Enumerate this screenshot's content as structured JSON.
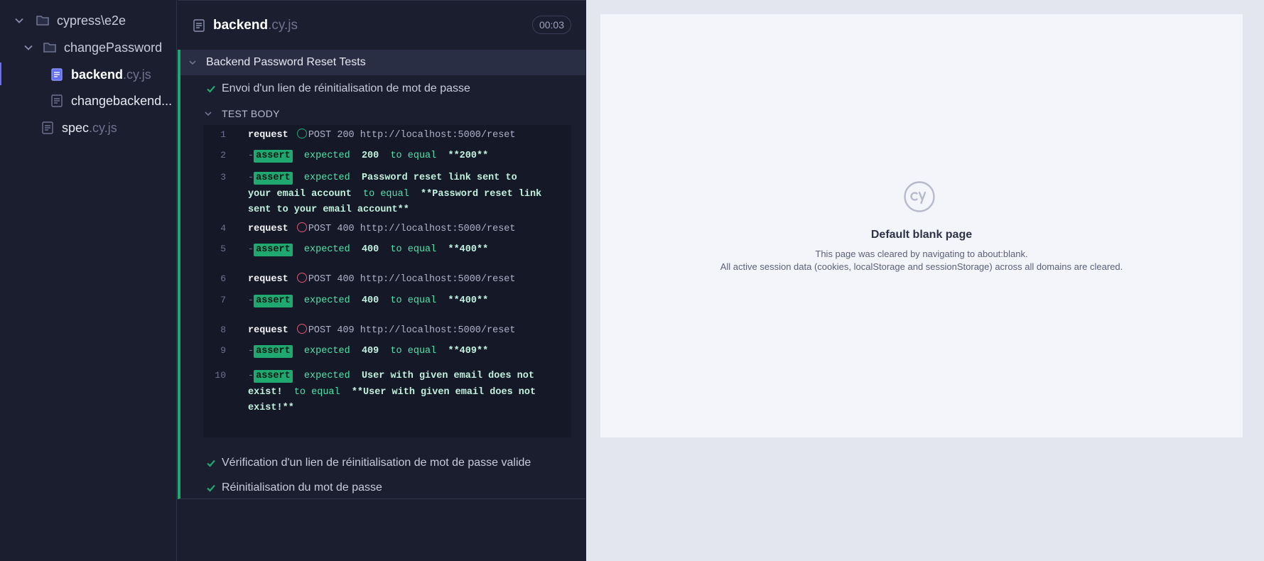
{
  "file_tree": {
    "root_folder": "cypress\\e2e",
    "sub_folder": "changePassword",
    "files": [
      {
        "name": "backend",
        "ext": ".cy.js"
      },
      {
        "name": "changebackend...",
        "ext": ""
      },
      {
        "name": "spec",
        "ext": ".cy.js"
      }
    ]
  },
  "reporter": {
    "spec_file": {
      "name": "backend",
      "ext": ".cy.js"
    },
    "duration": "00:03",
    "suite_title": "Backend Password Reset Tests",
    "tests": [
      "Envoi d'un lien de réinitialisation de mot de passe",
      "Vérification d'un lien de réinitialisation de mot de passe valide",
      "Réinitialisation du mot de passe"
    ],
    "body_label": "TEST BODY",
    "commands": [
      {
        "num": "1",
        "type": "request",
        "cmd": "request",
        "method": "POST",
        "status": "200",
        "url": "http://localhost:5000/reset",
        "ok": true
      },
      {
        "num": "2",
        "type": "assert",
        "dash": "-",
        "cmd": "assert",
        "expected_word": "expected",
        "actual": "200",
        "to_equal": "to equal",
        "expected": "**200**"
      },
      {
        "num": "3",
        "type": "assert",
        "dash": "-",
        "cmd": "assert",
        "expected_word": "expected",
        "actual_1": "Password reset link sent to",
        "actual_2": "your email account",
        "to_equal": "to equal",
        "expected_1": "**Password reset link",
        "expected_2": "sent to your email account**"
      },
      {
        "num": "4",
        "type": "request",
        "cmd": "request",
        "method": "POST",
        "status": "400",
        "url": "http://localhost:5000/reset",
        "ok": false
      },
      {
        "num": "5",
        "type": "assert",
        "dash": "-",
        "cmd": "assert",
        "expected_word": "expected",
        "actual": "400",
        "to_equal": "to equal",
        "expected": "**400**"
      },
      {
        "num": "6",
        "type": "request",
        "cmd": "request",
        "method": "POST",
        "status": "400",
        "url": "http://localhost:5000/reset",
        "ok": false
      },
      {
        "num": "7",
        "type": "assert",
        "dash": "-",
        "cmd": "assert",
        "expected_word": "expected",
        "actual": "400",
        "to_equal": "to equal",
        "expected": "**400**"
      },
      {
        "num": "8",
        "type": "request",
        "cmd": "request",
        "method": "POST",
        "status": "409",
        "url": "http://localhost:5000/reset",
        "ok": false
      },
      {
        "num": "9",
        "type": "assert",
        "dash": "-",
        "cmd": "assert",
        "expected_word": "expected",
        "actual": "409",
        "to_equal": "to equal",
        "expected": "**409**"
      },
      {
        "num": "10",
        "type": "assert",
        "dash": "-",
        "cmd": "assert",
        "expected_word": "expected",
        "actual_1": "User with given email does not",
        "actual_2": "exist!",
        "to_equal": "to equal",
        "expected_1": "**User with given email does not",
        "expected_2": "exist!**"
      }
    ]
  },
  "aut": {
    "title": "Default blank page",
    "line1": "This page was cleared by navigating to about:blank.",
    "line2": "All active session data (cookies, localStorage and sessionStorage) across all domains are cleared."
  },
  "colors": {
    "passed": "#1fa971",
    "failed": "#e45770",
    "accent": "#6470f3",
    "panel_bg": "#1b1e2e"
  }
}
